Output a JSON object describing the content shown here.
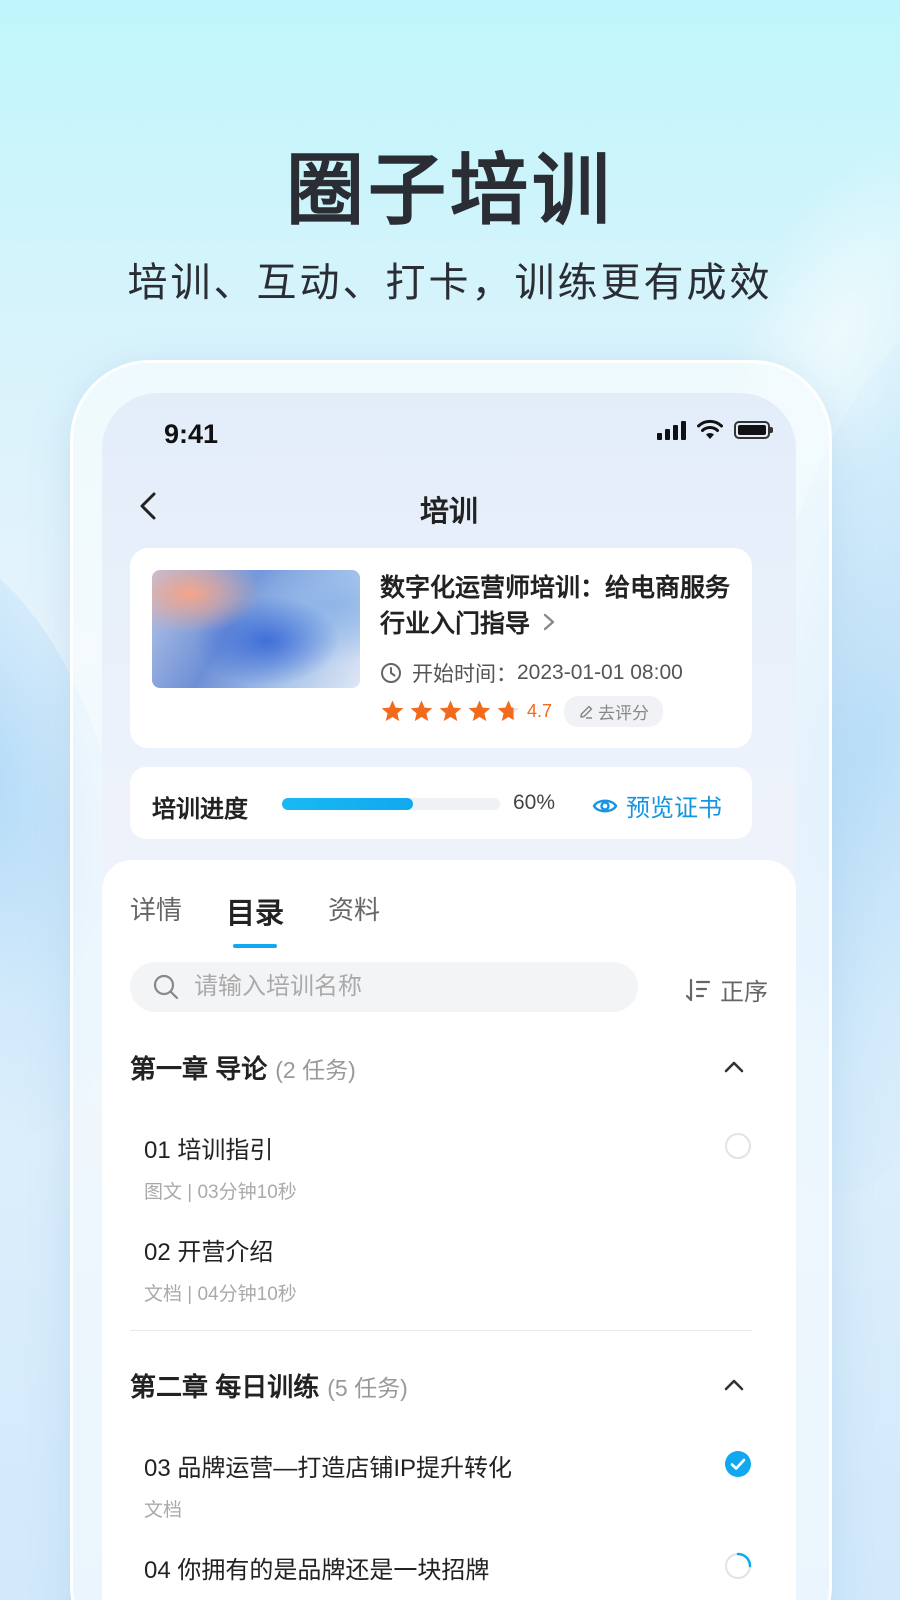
{
  "hero": {
    "title": "圈子培训",
    "subtitle": "培训、互动、打卡，训练更有成效"
  },
  "status_bar": {
    "time": "9:41",
    "icons": [
      "signal-icon",
      "wifi-icon",
      "battery-icon"
    ]
  },
  "nav": {
    "back_icon": "chevron-left-icon",
    "title": "培训"
  },
  "course": {
    "title": "数字化运营师培训：给电商服务行业入门指导",
    "start_label": "开始时间：",
    "start_time": "2023-01-01 08:00",
    "rating": 4.7,
    "rating_text": "4.7",
    "rate_button": "去评分"
  },
  "progress": {
    "label": "培训进度",
    "value": 0.6,
    "percent_text": "60%",
    "preview_label": "预览证书"
  },
  "tabs": [
    {
      "label": "详情",
      "active": false
    },
    {
      "label": "目录",
      "active": true
    },
    {
      "label": "资料",
      "active": false
    }
  ],
  "search": {
    "placeholder": "请输入培训名称",
    "sort_label": "正序"
  },
  "chapters": [
    {
      "title": "第一章  导论",
      "count": "(2 任务)",
      "lessons": [
        {
          "title": "01 培训指引",
          "meta": "图文 | 03分钟10秒",
          "status": "not-started"
        },
        {
          "title": "02 开营介绍",
          "meta": "文档 | 04分钟10秒",
          "status": "none"
        }
      ]
    },
    {
      "title": "第二章  每日训练",
      "count": "(5 任务)",
      "lessons": [
        {
          "title": "03 品牌运营—打造店铺IP提升转化",
          "meta": "文档",
          "status": "completed"
        },
        {
          "title": "04 你拥有的是品牌还是一块招牌",
          "meta": "",
          "status": "in-progress"
        }
      ]
    }
  ],
  "colors": {
    "accent": "#12a8ef",
    "star": "#f26b1d",
    "title": "#2a2d33"
  }
}
